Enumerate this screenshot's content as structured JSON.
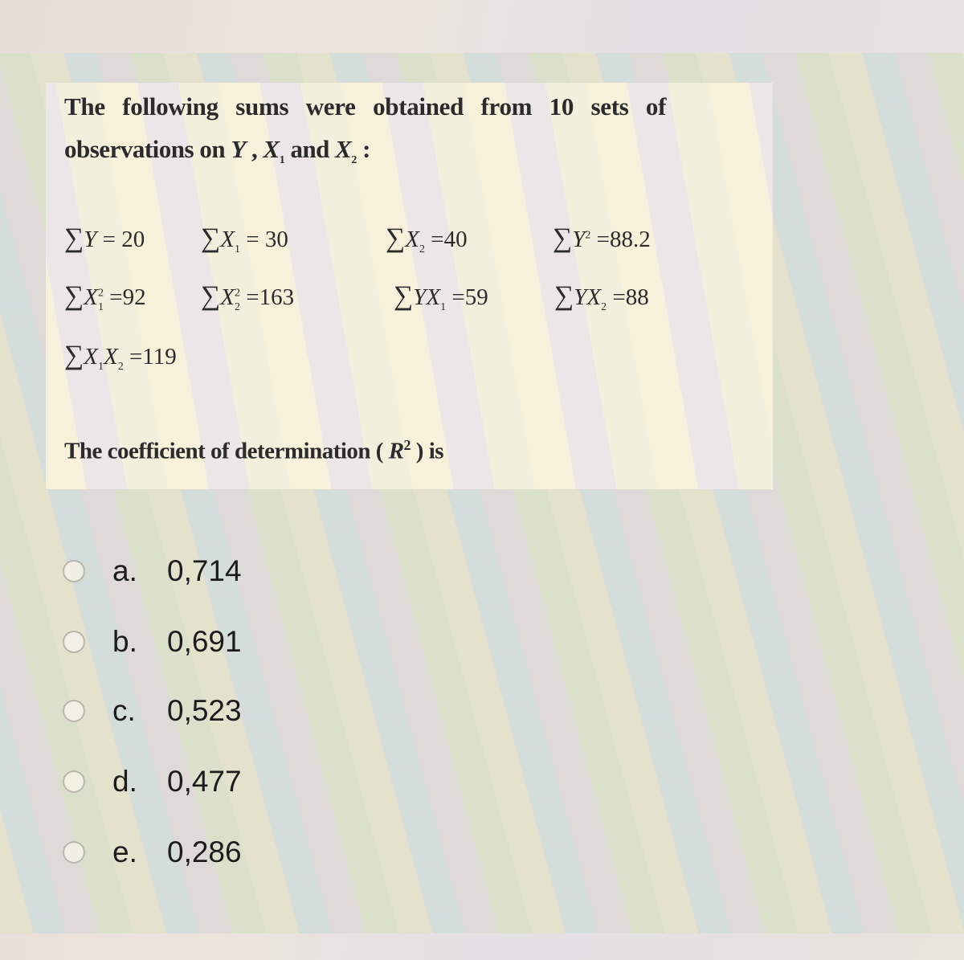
{
  "question": {
    "intro_line1": "The following sums were obtained from 10 sets of",
    "intro_line2_prefix": "observations on ",
    "var_y": "Y",
    "var_x": "X",
    "sub_1": "1",
    "sub_2": "2",
    "intro_line2_and": " and ",
    "intro_line2_suffix": " :",
    "comma": " , ",
    "sigma": "∑",
    "sums": [
      {
        "id": "sum_y",
        "label": "Y",
        "sub": "",
        "sup": "",
        "value": "= 20"
      },
      {
        "id": "sum_x1",
        "label": "X",
        "sub": "1",
        "sup": "",
        "value": "= 30"
      },
      {
        "id": "sum_x2",
        "label": "X",
        "sub": "2",
        "sup": "",
        "value": "=40"
      },
      {
        "id": "sum_y2",
        "label": "Y",
        "sub": "",
        "sup": "2",
        "value": "=88.2"
      },
      {
        "id": "sum_x1sq",
        "label": "X",
        "sub": "1",
        "sup": "2",
        "value": "=92"
      },
      {
        "id": "sum_x2sq",
        "label": "X",
        "sub": "2",
        "sup": "2",
        "value": "=163"
      },
      {
        "id": "sum_yx1",
        "label": "YX",
        "sub": "1",
        "sup": "",
        "value": "=59"
      },
      {
        "id": "sum_yx2",
        "label": "YX",
        "sub": "2",
        "sup": "",
        "value": "=88"
      },
      {
        "id": "sum_x1x2",
        "label_a": "X",
        "sub_a": "1",
        "label_b": "X",
        "sub_b": "2",
        "value": "=119"
      }
    ],
    "prompt_prefix": "The coefficient of determination ( ",
    "prompt_r": "R",
    "prompt_sup": "2",
    "prompt_suffix": " ) is"
  },
  "options": [
    {
      "letter": "a.",
      "value": "0,714",
      "selected": false
    },
    {
      "letter": "b.",
      "value": "0,691",
      "selected": false
    },
    {
      "letter": "c.",
      "value": "0,523",
      "selected": false
    },
    {
      "letter": "d.",
      "value": "0,477",
      "selected": false
    },
    {
      "letter": "e.",
      "value": "0,286",
      "selected": false
    }
  ]
}
